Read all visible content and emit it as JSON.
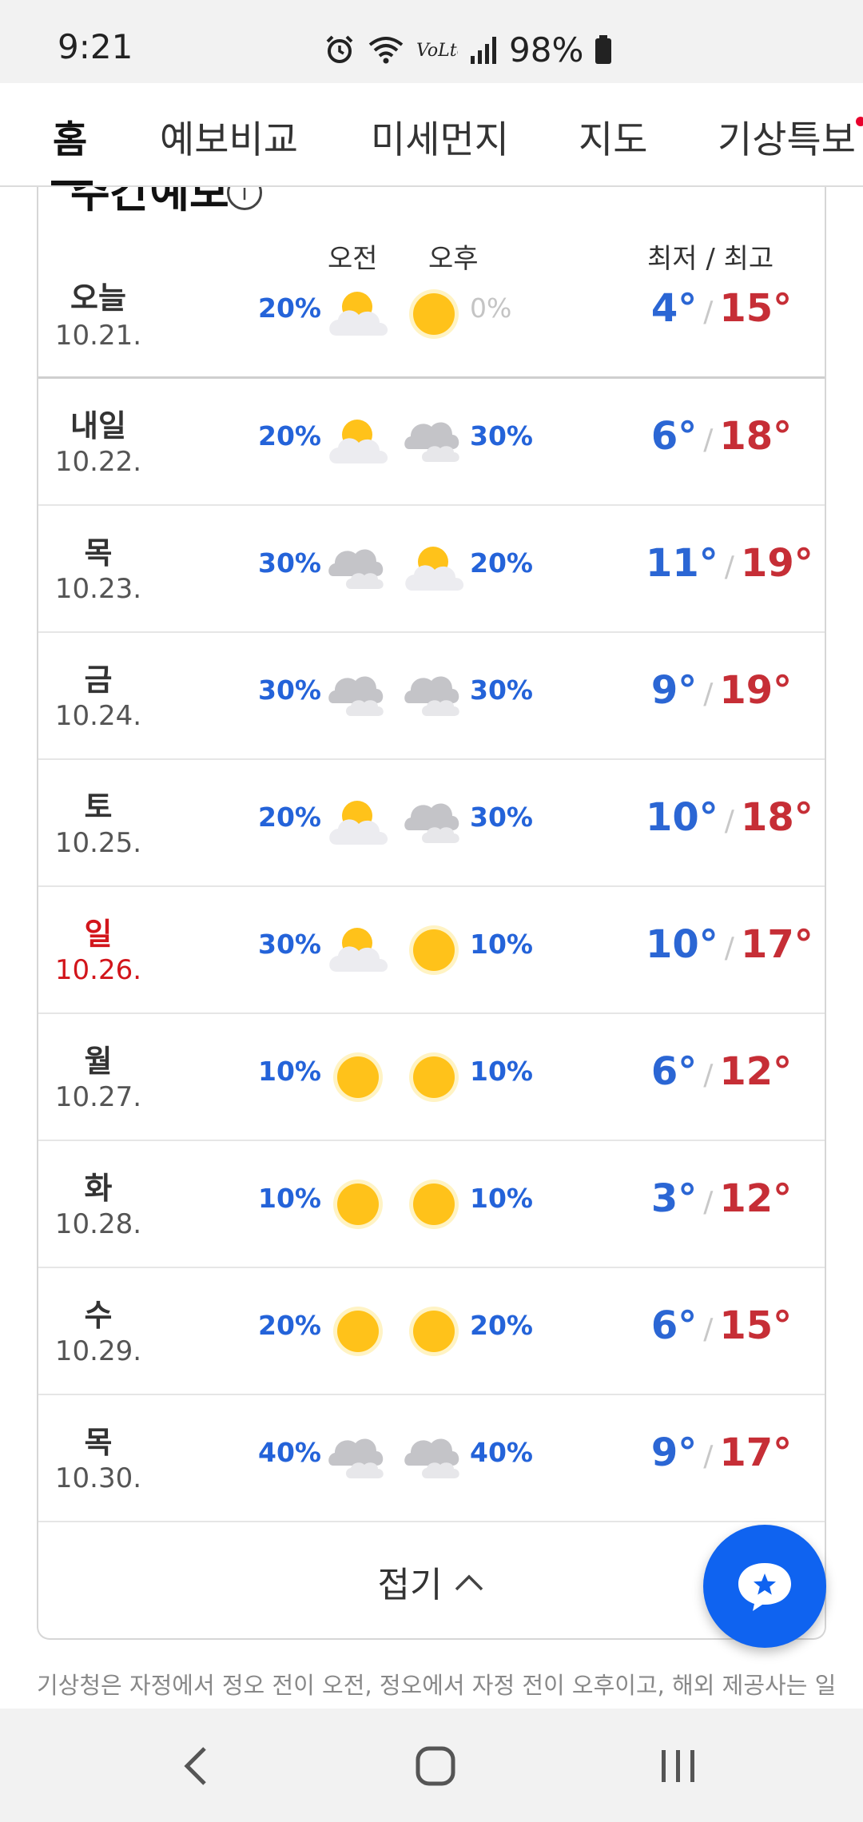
{
  "status": {
    "time": "9:21",
    "battery": "98%",
    "icons": [
      "alarm-icon",
      "wifi-icon",
      "volte-icon",
      "signal-icon",
      "battery-icon"
    ]
  },
  "tabs": [
    {
      "label": "홈",
      "active": true
    },
    {
      "label": "예보비교",
      "active": false
    },
    {
      "label": "미세먼지",
      "active": false
    },
    {
      "label": "지도",
      "active": false
    },
    {
      "label": "기상특보",
      "active": false,
      "new_dot": true
    }
  ],
  "forecast": {
    "title": "주간예보",
    "header_am": "오전",
    "header_pm": "오후",
    "header_temp": "최저 / 최고",
    "days": [
      {
        "day": "오늘",
        "date": "10.21.",
        "rain_am": "20%",
        "icon_am": "partly-cloudy-icon",
        "icon_pm": "sunny-icon",
        "rain_pm": "0%",
        "low": "4°",
        "high": "15°",
        "sunday": false
      },
      {
        "day": "내일",
        "date": "10.22.",
        "rain_am": "20%",
        "icon_am": "partly-cloudy-icon",
        "icon_pm": "cloudy-icon",
        "rain_pm": "30%",
        "low": "6°",
        "high": "18°",
        "sunday": false
      },
      {
        "day": "목",
        "date": "10.23.",
        "rain_am": "30%",
        "icon_am": "cloudy-icon",
        "icon_pm": "partly-cloudy-icon",
        "rain_pm": "20%",
        "low": "11°",
        "high": "19°",
        "sunday": false
      },
      {
        "day": "금",
        "date": "10.24.",
        "rain_am": "30%",
        "icon_am": "cloudy-icon",
        "icon_pm": "cloudy-icon",
        "rain_pm": "30%",
        "low": "9°",
        "high": "19°",
        "sunday": false
      },
      {
        "day": "토",
        "date": "10.25.",
        "rain_am": "20%",
        "icon_am": "partly-cloudy-icon",
        "icon_pm": "cloudy-icon",
        "rain_pm": "30%",
        "low": "10°",
        "high": "18°",
        "sunday": false
      },
      {
        "day": "일",
        "date": "10.26.",
        "rain_am": "30%",
        "icon_am": "partly-cloudy-icon",
        "icon_pm": "sunny-icon",
        "rain_pm": "10%",
        "low": "10°",
        "high": "17°",
        "sunday": true
      },
      {
        "day": "월",
        "date": "10.27.",
        "rain_am": "10%",
        "icon_am": "sunny-icon",
        "icon_pm": "sunny-icon",
        "rain_pm": "10%",
        "low": "6°",
        "high": "12°",
        "sunday": false
      },
      {
        "day": "화",
        "date": "10.28.",
        "rain_am": "10%",
        "icon_am": "sunny-icon",
        "icon_pm": "sunny-icon",
        "rain_pm": "10%",
        "low": "3°",
        "high": "12°",
        "sunday": false
      },
      {
        "day": "수",
        "date": "10.29.",
        "rain_am": "20%",
        "icon_am": "sunny-icon",
        "icon_pm": "sunny-icon",
        "rain_pm": "20%",
        "low": "6°",
        "high": "15°",
        "sunday": false
      },
      {
        "day": "목",
        "date": "10.30.",
        "rain_am": "40%",
        "icon_am": "cloudy-icon",
        "icon_pm": "cloudy-icon",
        "rain_pm": "40%",
        "low": "9°",
        "high": "17°",
        "sunday": false
      }
    ],
    "fold_label": "접기"
  },
  "footnote": "기상청은 자정에서 정오 전이 오전, 정오에서 자정 전이 오후이고, 해외 제공사는 일",
  "colors": {
    "rain": "#2463d9",
    "low_temp": "#2b66d4",
    "high_temp": "#c62e36",
    "sunday": "#d2151b",
    "fab": "#0f63f0",
    "sun": "#ffc21a"
  }
}
